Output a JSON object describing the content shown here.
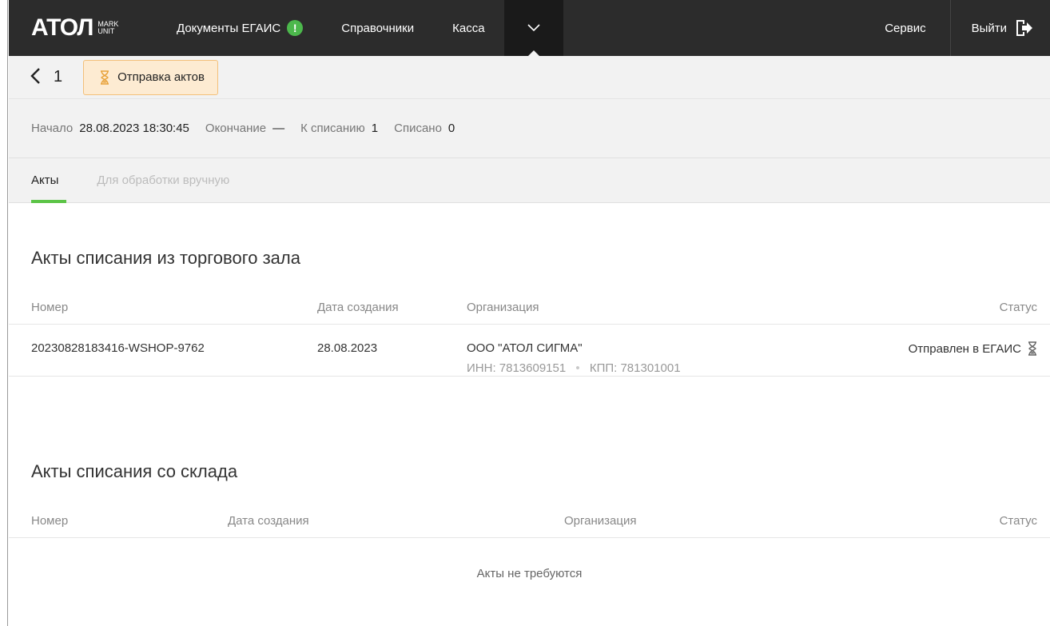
{
  "brand": {
    "name": "АТОЛ",
    "sub1": "MARK",
    "sub2": "UNIT"
  },
  "nav": {
    "items": [
      {
        "label": "Документы ЕГАИС",
        "badge": "!"
      },
      {
        "label": "Справочники"
      },
      {
        "label": "Касса"
      }
    ],
    "service": "Сервис",
    "exit": "Выйти"
  },
  "subheader": {
    "back": "‹",
    "number": "1",
    "status": "Отправка актов"
  },
  "info": {
    "start_label": "Начало",
    "start_value": "28.08.2023 18:30:45",
    "end_label": "Окончание",
    "end_value": "—",
    "to_writeoff_label": "К списанию",
    "to_writeoff_value": "1",
    "written_label": "Списано",
    "written_value": "0"
  },
  "tabs": [
    {
      "label": "Акты",
      "active": true
    },
    {
      "label": "Для обработки вручную",
      "active": false
    }
  ],
  "hall": {
    "title": "Акты списания из торгового зала",
    "columns": [
      "Номер",
      "Дата создания",
      "Организация",
      "Статус"
    ],
    "rows": [
      {
        "number": "20230828183416-WSHOP-9762",
        "date": "28.08.2023",
        "org": "ООО \"АТОЛ СИГМА\"",
        "inn": "ИНН: 7813609151",
        "kpp": "КПП: 781301001",
        "status": "Отправлен в ЕГАИС"
      }
    ]
  },
  "warehouse": {
    "title": "Акты списания со склада",
    "columns": [
      "Номер",
      "Дата создания",
      "Организация",
      "Статус"
    ],
    "empty": "Акты не требуются"
  },
  "colors": {
    "accent": "#5cc447",
    "nav_bg": "#2c2c2c",
    "pill_bg": "#fdebd2",
    "pill_border": "#f3c07a"
  }
}
